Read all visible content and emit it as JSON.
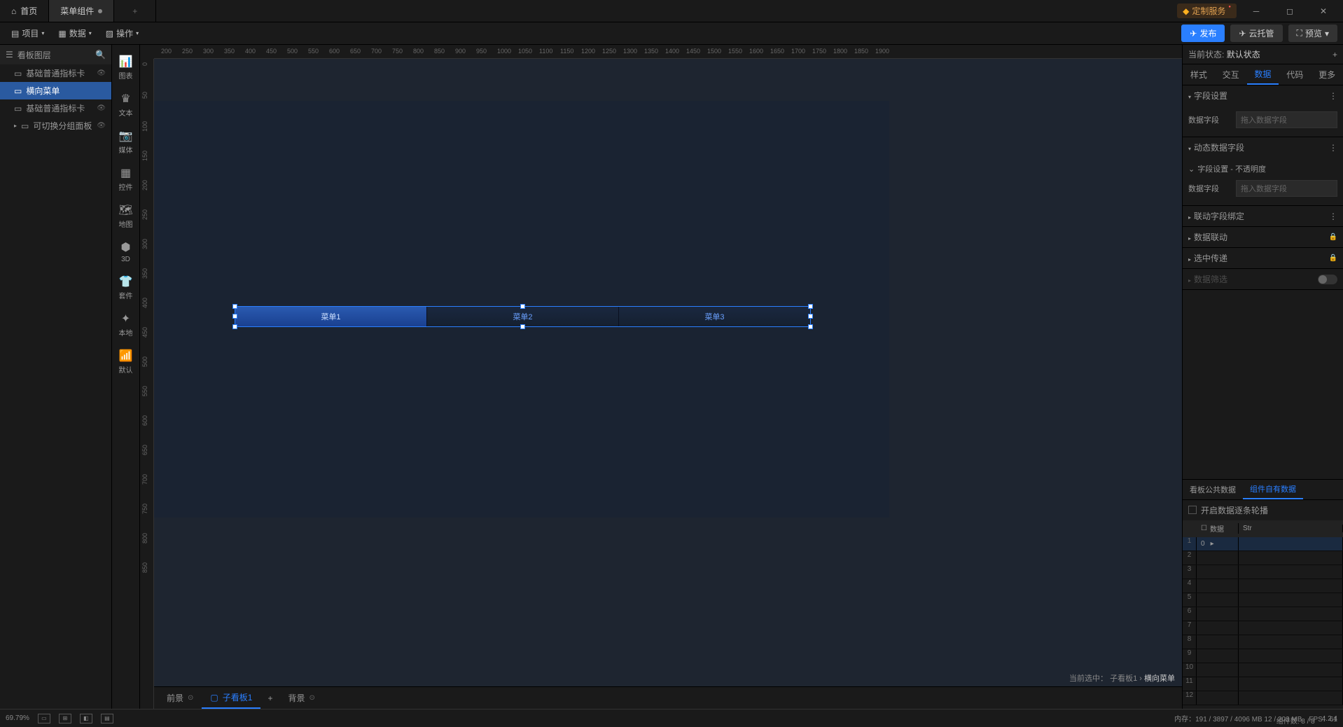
{
  "titleBar": {
    "home": "首页",
    "activeTab": "菜单组件",
    "premium": "定制服务"
  },
  "menuBar": {
    "project": "项目",
    "data": "数据",
    "operate": "操作",
    "publish": "发布",
    "cloud": "云托管",
    "preview": "预览"
  },
  "layerPanel": {
    "title": "看板图层",
    "items": [
      {
        "label": "基础普通指标卡",
        "icon": "bar",
        "active": false,
        "eye": true
      },
      {
        "label": "横向菜单",
        "icon": "menu",
        "active": true,
        "eye": false
      },
      {
        "label": "基础普通指标卡",
        "icon": "bar",
        "active": false,
        "eye": true
      },
      {
        "label": "可切换分组面板 (...",
        "icon": "group",
        "active": false,
        "eye": true,
        "expandable": true
      }
    ]
  },
  "compSidebar": [
    {
      "label": "图表",
      "key": "chart"
    },
    {
      "label": "文本",
      "key": "text"
    },
    {
      "label": "媒体",
      "key": "media"
    },
    {
      "label": "控件",
      "key": "control"
    },
    {
      "label": "地图",
      "key": "map"
    },
    {
      "label": "3D",
      "key": "3d"
    },
    {
      "label": "套件",
      "key": "kit"
    },
    {
      "label": "本地",
      "key": "local"
    },
    {
      "label": "默认",
      "key": "default"
    }
  ],
  "rulerH": [
    "200",
    "250",
    "300",
    "350",
    "400",
    "450",
    "500",
    "550",
    "600",
    "650",
    "700",
    "750",
    "800",
    "850",
    "900",
    "950",
    "1000",
    "1050",
    "1100",
    "1150",
    "1200",
    "1250",
    "1300",
    "1350",
    "1400",
    "1450",
    "1500",
    "1550",
    "1600",
    "1650",
    "1700",
    "1750",
    "1800",
    "1850",
    "1900"
  ],
  "rulerV": [
    "0",
    "50",
    "100",
    "150",
    "200",
    "250",
    "300",
    "350",
    "400",
    "450",
    "500",
    "550",
    "600",
    "650",
    "700",
    "750",
    "800",
    "850"
  ],
  "menuWidget": [
    "菜单1",
    "菜单2",
    "菜单3"
  ],
  "breadcrumb": {
    "prefix": "当前选中：",
    "path1": "子看板1",
    "path2": "横向菜单"
  },
  "canvasTabs": {
    "front": "前景",
    "sub": "子看板1",
    "back": "背景"
  },
  "rightPanel": {
    "stateLabel": "当前状态:",
    "stateValue": "默认状态",
    "tabs": [
      "样式",
      "交互",
      "数据",
      "代码",
      "更多"
    ],
    "activeTab": 2,
    "sections": {
      "fieldSettings": "字段设置",
      "dataField": "数据字段",
      "dataFieldPlaceholder": "拖入数据字段",
      "dynamicField": "动态数据字段",
      "fieldOpacity": "字段设置 - 不透明度",
      "linkedBinding": "联动字段绑定",
      "dataLink": "数据联动",
      "selectPass": "选中传递",
      "dataFilter": "数据筛选"
    },
    "dataTabs": [
      "看板公共数据",
      "组件自有数据"
    ],
    "dataTabActive": 1,
    "enableLoop": "开启数据逐条轮播",
    "gridHeaders": [
      "数据",
      "Str"
    ],
    "gridRows": [
      [
        "0"
      ],
      [
        ""
      ],
      [
        ""
      ],
      [
        ""
      ],
      [
        ""
      ],
      [
        ""
      ],
      [
        ""
      ],
      [
        ""
      ],
      [
        ""
      ],
      [
        ""
      ],
      [
        ""
      ],
      [
        ""
      ]
    ]
  },
  "statusBar": {
    "zoom": "69.79%",
    "memory": "内存：191 / 3897 / 4096 MB  12 / 203 MB",
    "components": "组件数: 8 / 8",
    "fps": "FPS：61",
    "version": "4.2.4"
  }
}
